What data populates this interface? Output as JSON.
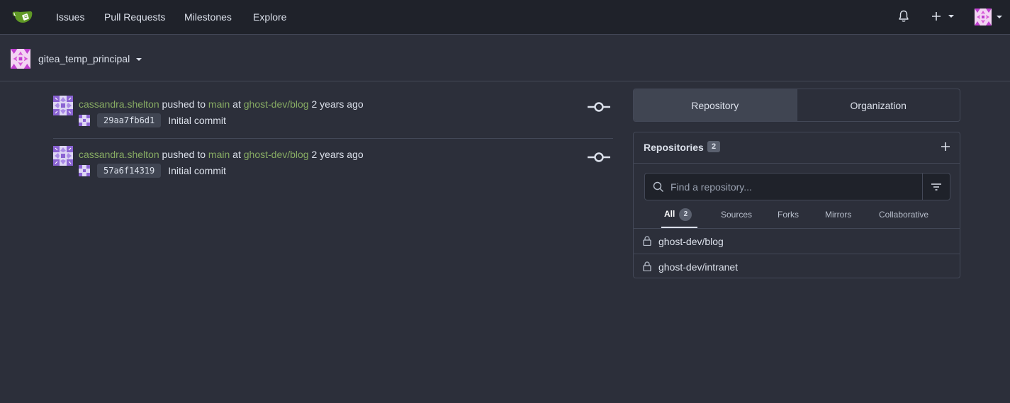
{
  "colors": {
    "link_green": "#87ab63",
    "navbar_bg": "#1f222a",
    "page_bg": "#2c2f3a"
  },
  "nav": {
    "logo_icon": "gitea-logo-icon",
    "items": [
      "Issues",
      "Pull Requests",
      "Milestones",
      "Explore"
    ],
    "right_icons": [
      "bell-icon",
      "plus-icon",
      "avatar"
    ]
  },
  "context": {
    "user": "gitea_temp_principal"
  },
  "feed": [
    {
      "user": "cassandra.shelton",
      "action": "pushed to",
      "branch": "main",
      "at": "at",
      "repo": "ghost-dev/blog",
      "time": "2 years ago",
      "sha": "29aa7fb6d1",
      "message": "Initial commit"
    },
    {
      "user": "cassandra.shelton",
      "action": "pushed to",
      "branch": "main",
      "at": "at",
      "repo": "ghost-dev/blog",
      "time": "2 years ago",
      "sha": "57a6f14319",
      "message": "Initial commit"
    }
  ],
  "tabs": {
    "repository": "Repository",
    "organization": "Organization"
  },
  "repos": {
    "title": "Repositories",
    "count": "2",
    "search_placeholder": "Find a repository...",
    "subtabs": {
      "all": "All",
      "all_count": "2",
      "sources": "Sources",
      "forks": "Forks",
      "mirrors": "Mirrors",
      "collaborative": "Collaborative"
    },
    "list": [
      "ghost-dev/blog",
      "ghost-dev/intranet"
    ]
  }
}
